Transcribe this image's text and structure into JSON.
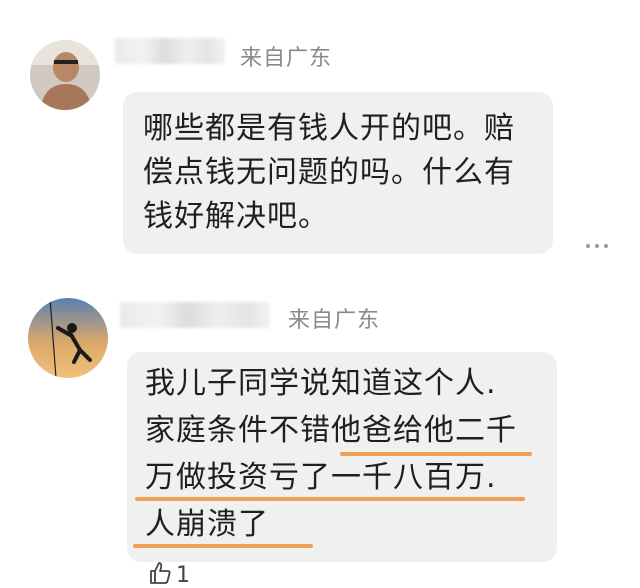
{
  "comments": [
    {
      "location": "来自广东",
      "lines": [
        "哪些都是有钱人开的吧。赔",
        "偿点钱无问题的吗。什么有",
        "钱好解决吧。"
      ]
    },
    {
      "location": "来自广东",
      "lines": [
        "我儿子同学说知道这个人.",
        "家庭条件不错他爸给他二千",
        "万做投资亏了一千八百万.",
        "人崩溃了"
      ],
      "like_count": "1"
    }
  ],
  "colors": {
    "highlight_underline": "#f0a050",
    "bubble": "#f0f0f0"
  }
}
